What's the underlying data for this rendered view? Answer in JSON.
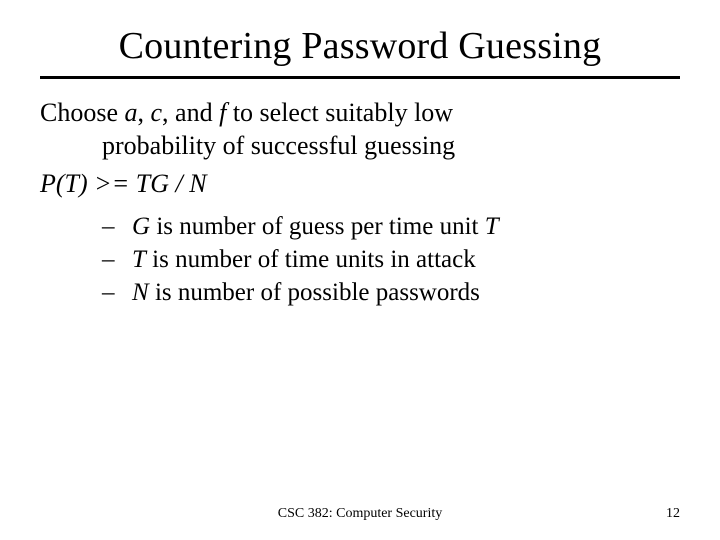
{
  "title": "Countering Password Guessing",
  "intro": {
    "line1_pre": "Choose ",
    "a": "a",
    "sep1": ", ",
    "c": "c",
    "sep2": ", and ",
    "f": "f",
    "line1_post": " to select suitably low",
    "line2": "probability of successful guessing"
  },
  "formula": "P(T)  >= TG / N",
  "bullets": [
    {
      "var": "G",
      "mid": " is number of guess per time unit ",
      "tail": "T"
    },
    {
      "var": "T",
      "mid": " is number of time units in attack",
      "tail": ""
    },
    {
      "var": "N",
      "mid": " is number of possible passwords",
      "tail": ""
    }
  ],
  "dash": "–",
  "footer": {
    "course": "CSC 382: Computer Security",
    "page": "12"
  }
}
